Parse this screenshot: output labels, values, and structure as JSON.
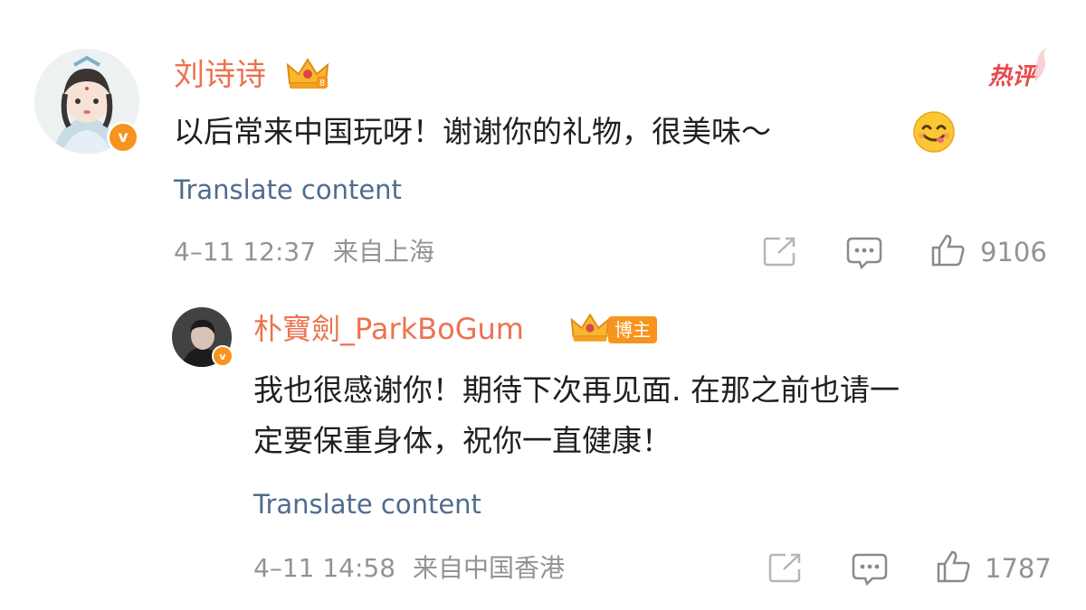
{
  "comment": {
    "author": "刘诗诗",
    "hot_label": "热评",
    "text": "以后常来中国玩呀！谢谢你的礼物，很美味～",
    "emoji": "😋",
    "translate": "Translate content",
    "date": "4–11 12:37",
    "location": "来自上海",
    "likes": "9106"
  },
  "reply": {
    "author": "朴寶劍_ParkBoGum",
    "role_badge": "博主",
    "text_line1": "我也很感谢你！期待下次再见面. 在那之前也请一",
    "text_line2": "定要保重身体，祝你一直健康！",
    "translate": "Translate content",
    "date": "4–11 14:58",
    "location": "来自中国香港",
    "likes": "1787"
  },
  "colors": {
    "name": "#eb7350",
    "translate": "#4f6c8f",
    "meta": "#939393",
    "verified": "#f7941d",
    "hot": "#e8484c"
  },
  "icons": [
    "verified-icon",
    "crown-icon",
    "share-icon",
    "comment-icon",
    "like-icon"
  ]
}
